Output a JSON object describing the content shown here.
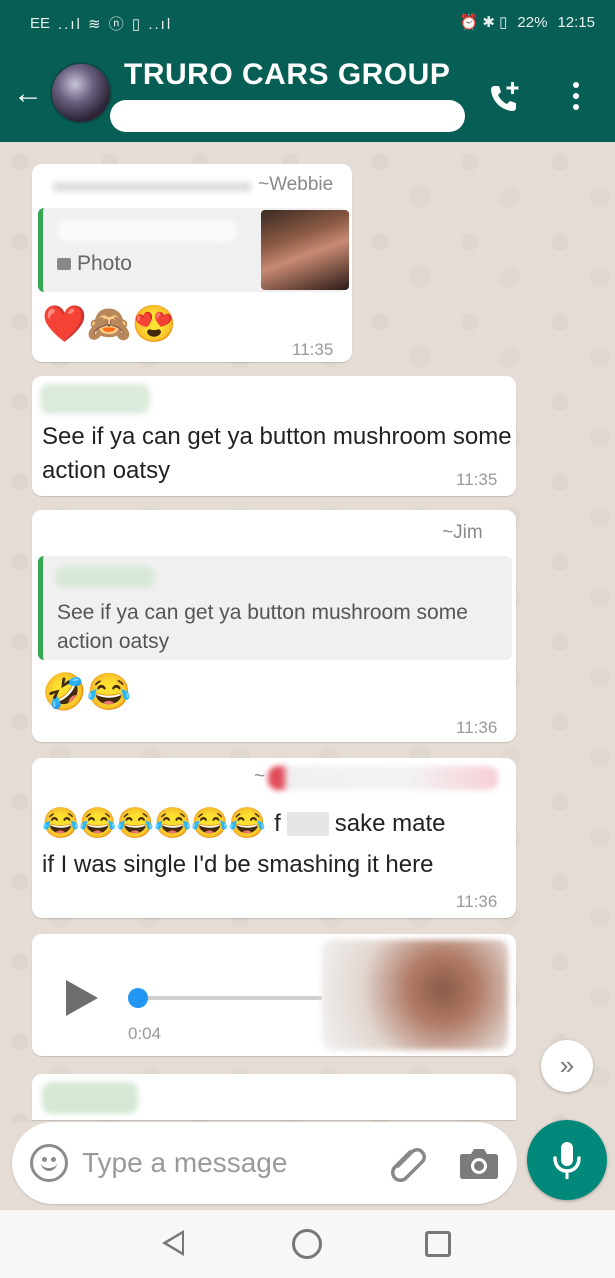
{
  "status_bar": {
    "carrier": "EE",
    "signal_icons": "..ıl ≋ ⓝ ▯ ..ıl",
    "right_icons": "⏰ ✱ ▯",
    "battery": "22%",
    "time": "12:15"
  },
  "header": {
    "title": "TRURO CARS GROUP"
  },
  "messages": [
    {
      "sender": "~Webbie",
      "quote_label": "Photo",
      "emojis": "❤️🙈😍",
      "time": "11:35"
    },
    {
      "text": "See if ya can get ya button mushroom some action oatsy",
      "time": "11:35"
    },
    {
      "sender": "~Jim",
      "quote_text": "See if ya can get ya button mushroom some action oatsy",
      "emojis": "🤣😂",
      "time": "11:36"
    },
    {
      "sender": "~",
      "emojis": "😂😂😂😂😂😂",
      "text_part1": "f",
      "text_part2": "sake mate",
      "text_line2": "if I was single I'd be smashing it here",
      "time": "11:36"
    },
    {
      "audio_duration": "0:04"
    }
  ],
  "scroll_button": "»",
  "input": {
    "placeholder": "Type a message"
  },
  "colors": {
    "header_green": "#075e54",
    "quote_bar": "#34a853",
    "mic_button": "#00897b",
    "audio_dot": "#2196f3"
  }
}
